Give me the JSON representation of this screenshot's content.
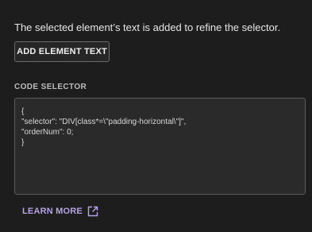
{
  "description": "The selected element’s text is added to refine the selector.",
  "add_button_label": "ADD ELEMENT TEXT",
  "section_label": "CODE SELECTOR",
  "code_lines": [
    "{",
    "\"selector\": \"DIV[class*=\\\"padding-horizontal\\\"]\",",
    "\"orderNum\": 0;",
    "}"
  ],
  "learn_more_label": "LEARN MORE",
  "learn_more_icon": "external-link-icon",
  "colors": {
    "background": "#1d1d1d",
    "accent": "#b6a3e6",
    "code_background": "#2a2a2a"
  }
}
